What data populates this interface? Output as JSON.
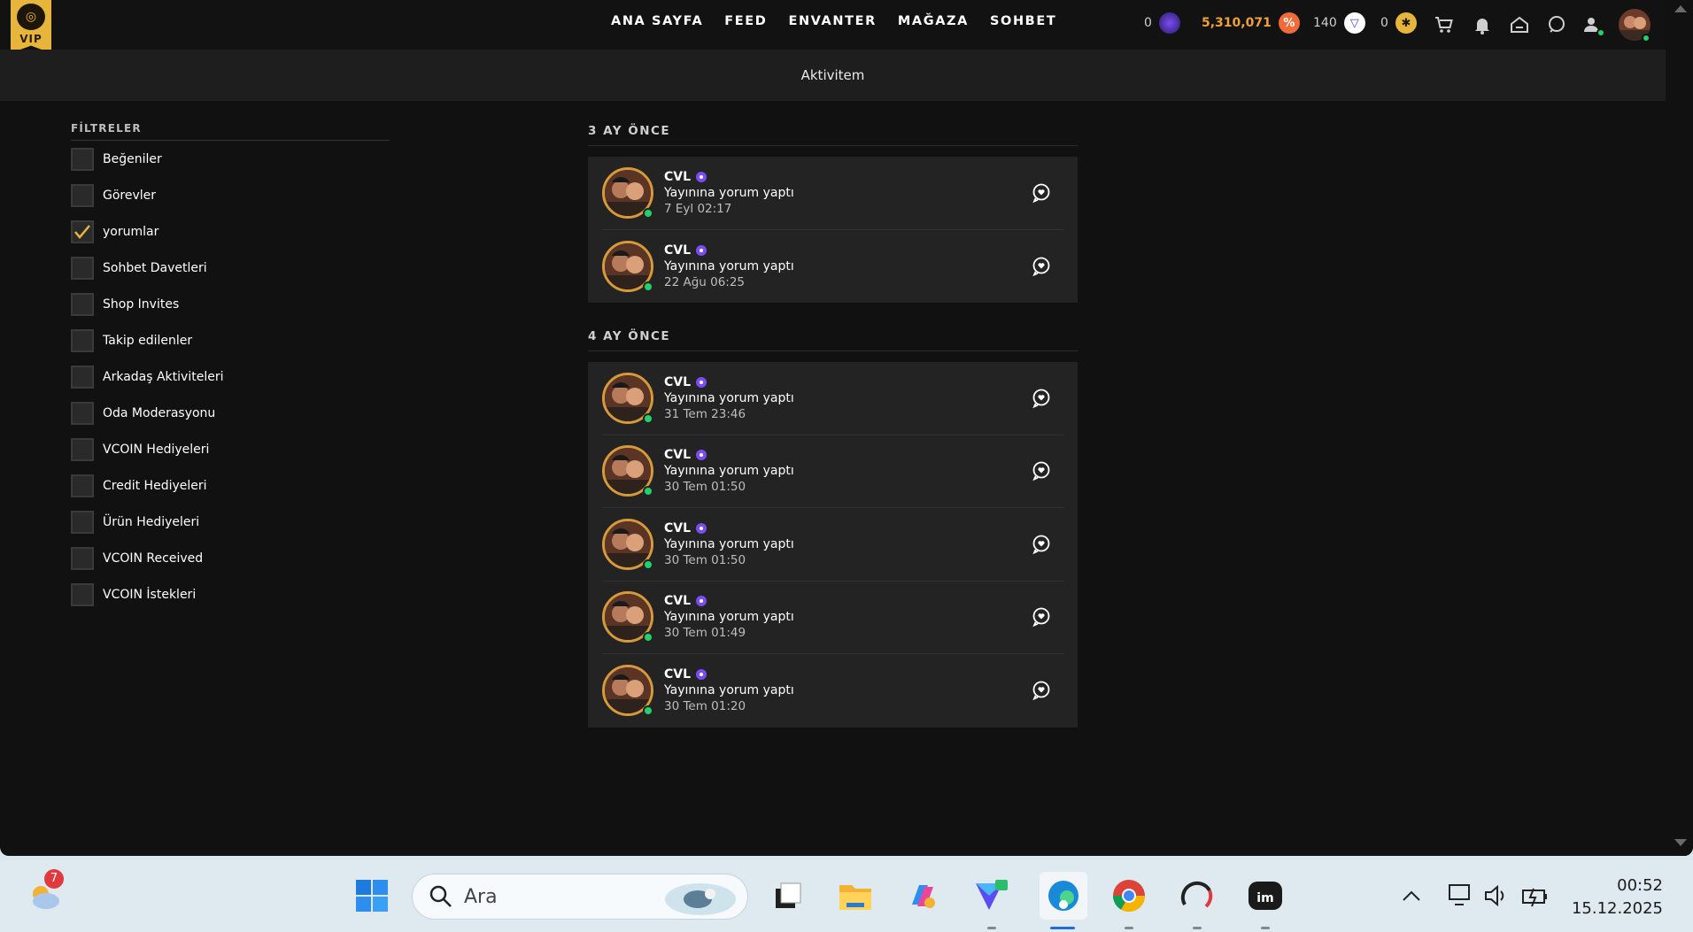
{
  "nav": {
    "vip_label": "VIP",
    "links": [
      "ANA SAYFA",
      "FEED",
      "ENVANTER",
      "MAĞAZA",
      "SOHBET"
    ],
    "vcoin": "0",
    "credits": "5,310,071",
    "promo_credits": "140",
    "vip_points": "0"
  },
  "subheader": {
    "title": "Aktivitem"
  },
  "filters": {
    "title": "FİLTRELER",
    "items": [
      {
        "label": "Beğeniler",
        "checked": false
      },
      {
        "label": "Görevler",
        "checked": false
      },
      {
        "label": "yorumlar",
        "checked": true
      },
      {
        "label": "Sohbet Davetleri",
        "checked": false
      },
      {
        "label": "Shop Invites",
        "checked": false
      },
      {
        "label": "Takip edilenler",
        "checked": false
      },
      {
        "label": "Arkadaş Aktiviteleri",
        "checked": false
      },
      {
        "label": "Oda Moderasyonu",
        "checked": false
      },
      {
        "label": "VCOIN Hediyeleri",
        "checked": false
      },
      {
        "label": "Credit Hediyeleri",
        "checked": false
      },
      {
        "label": "Ürün Hediyeleri",
        "checked": false
      },
      {
        "label": "VCOIN Received",
        "checked": false
      },
      {
        "label": "VCOIN İstekleri",
        "checked": false
      }
    ]
  },
  "feed": {
    "sections": [
      {
        "title": "3 AY ÖNCE",
        "items": [
          {
            "name": "CVL",
            "action": "Yayınına yorum yaptı",
            "time": "7 Eyl 02:17"
          },
          {
            "name": "CVL",
            "action": "Yayınına yorum yaptı",
            "time": "22 Ağu 06:25"
          }
        ]
      },
      {
        "title": "4 AY ÖNCE",
        "items": [
          {
            "name": "CVL",
            "action": "Yayınına yorum yaptı",
            "time": "31 Tem 23:46"
          },
          {
            "name": "CVL",
            "action": "Yayınına yorum yaptı",
            "time": "30 Tem 01:50"
          },
          {
            "name": "CVL",
            "action": "Yayınına yorum yaptı",
            "time": "30 Tem 01:50"
          },
          {
            "name": "CVL",
            "action": "Yayınına yorum yaptı",
            "time": "30 Tem 01:49"
          },
          {
            "name": "CVL",
            "action": "Yayınına yorum yaptı",
            "time": "30 Tem 01:20"
          }
        ]
      }
    ]
  },
  "taskbar": {
    "weather_badge": "7",
    "search_placeholder": "Ara",
    "time": "00:52",
    "date": "15.12.2025"
  },
  "colors": {
    "accent_gold": "#e7b53c",
    "credits_orange": "#f0a03a",
    "online_green": "#22d06e",
    "verified_purple": "#7b4cf0"
  }
}
